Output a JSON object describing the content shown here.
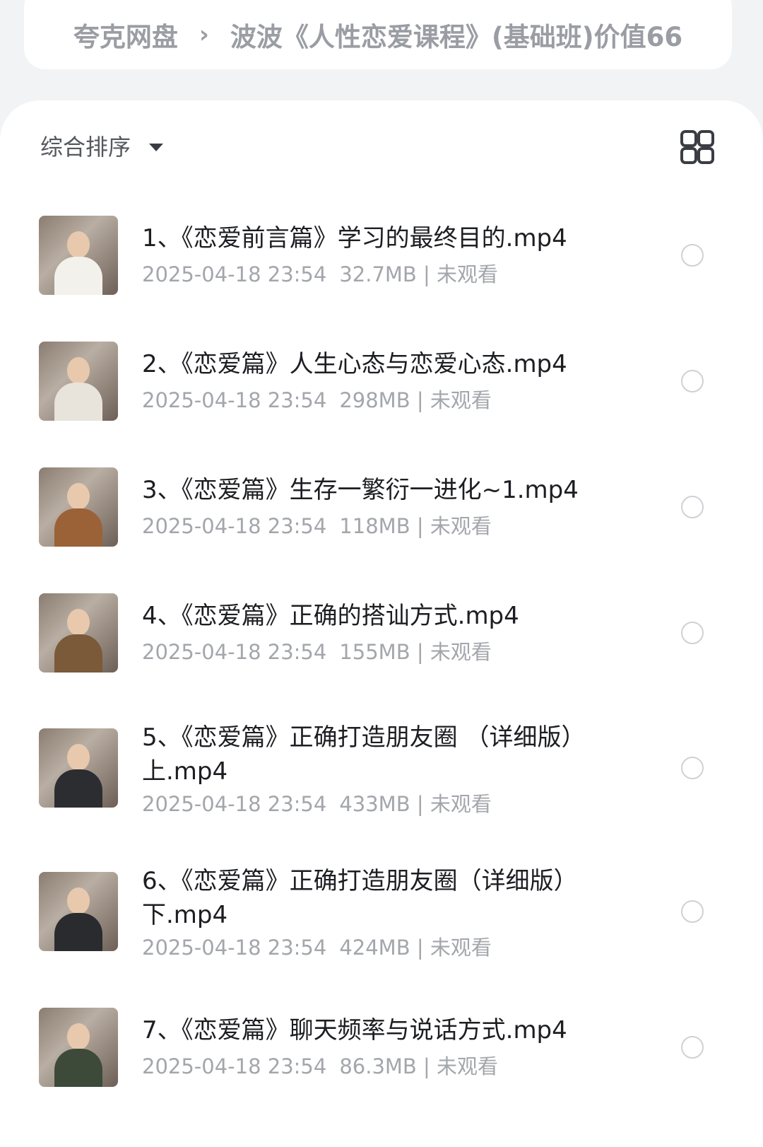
{
  "breadcrumb": {
    "root": "夸克网盘",
    "separator": "›",
    "current": "波波《人性恋爱课程》(基础班)价值66"
  },
  "toolbar": {
    "sort_label": "综合排序",
    "view_icon": "grid-view-icon"
  },
  "colors": {
    "background": "#f2f3f5",
    "card": "#ffffff",
    "title_text": "#1d1e22",
    "meta_text": "#a3a6ab",
    "breadcrumb_text": "#9a9da3"
  },
  "files": [
    {
      "name": "1、《恋爱前言篇》学习的最终目的.mp4",
      "date": "2025-04-18 23:54",
      "size": "32.7MB",
      "status": "未观看",
      "thumbnail": "video-thumbnail"
    },
    {
      "name": "2、《恋爱篇》人生心态与恋爱心态.mp4",
      "date": "2025-04-18 23:54",
      "size": "298MB",
      "status": "未观看",
      "thumbnail": "video-thumbnail"
    },
    {
      "name": "3、《恋爱篇》生存一繁衍一进化~1.mp4",
      "date": "2025-04-18 23:54",
      "size": "118MB",
      "status": "未观看",
      "thumbnail": "video-thumbnail"
    },
    {
      "name": "4、《恋爱篇》正确的搭讪方式.mp4",
      "date": "2025-04-18 23:54",
      "size": "155MB",
      "status": "未观看",
      "thumbnail": "video-thumbnail"
    },
    {
      "name": "5、《恋爱篇》正确打造朋友圈 （详细版）上.mp4",
      "date": "2025-04-18 23:54",
      "size": "433MB",
      "status": "未观看",
      "thumbnail": "video-thumbnail"
    },
    {
      "name": "6、《恋爱篇》正确打造朋友圈（详细版）下.mp4",
      "date": "2025-04-18 23:54",
      "size": "424MB",
      "status": "未观看",
      "thumbnail": "video-thumbnail"
    },
    {
      "name": "7、《恋爱篇》聊天频率与说话方式.mp4",
      "date": "2025-04-18 23:54",
      "size": "86.3MB",
      "status": "未观看",
      "thumbnail": "video-thumbnail"
    }
  ]
}
